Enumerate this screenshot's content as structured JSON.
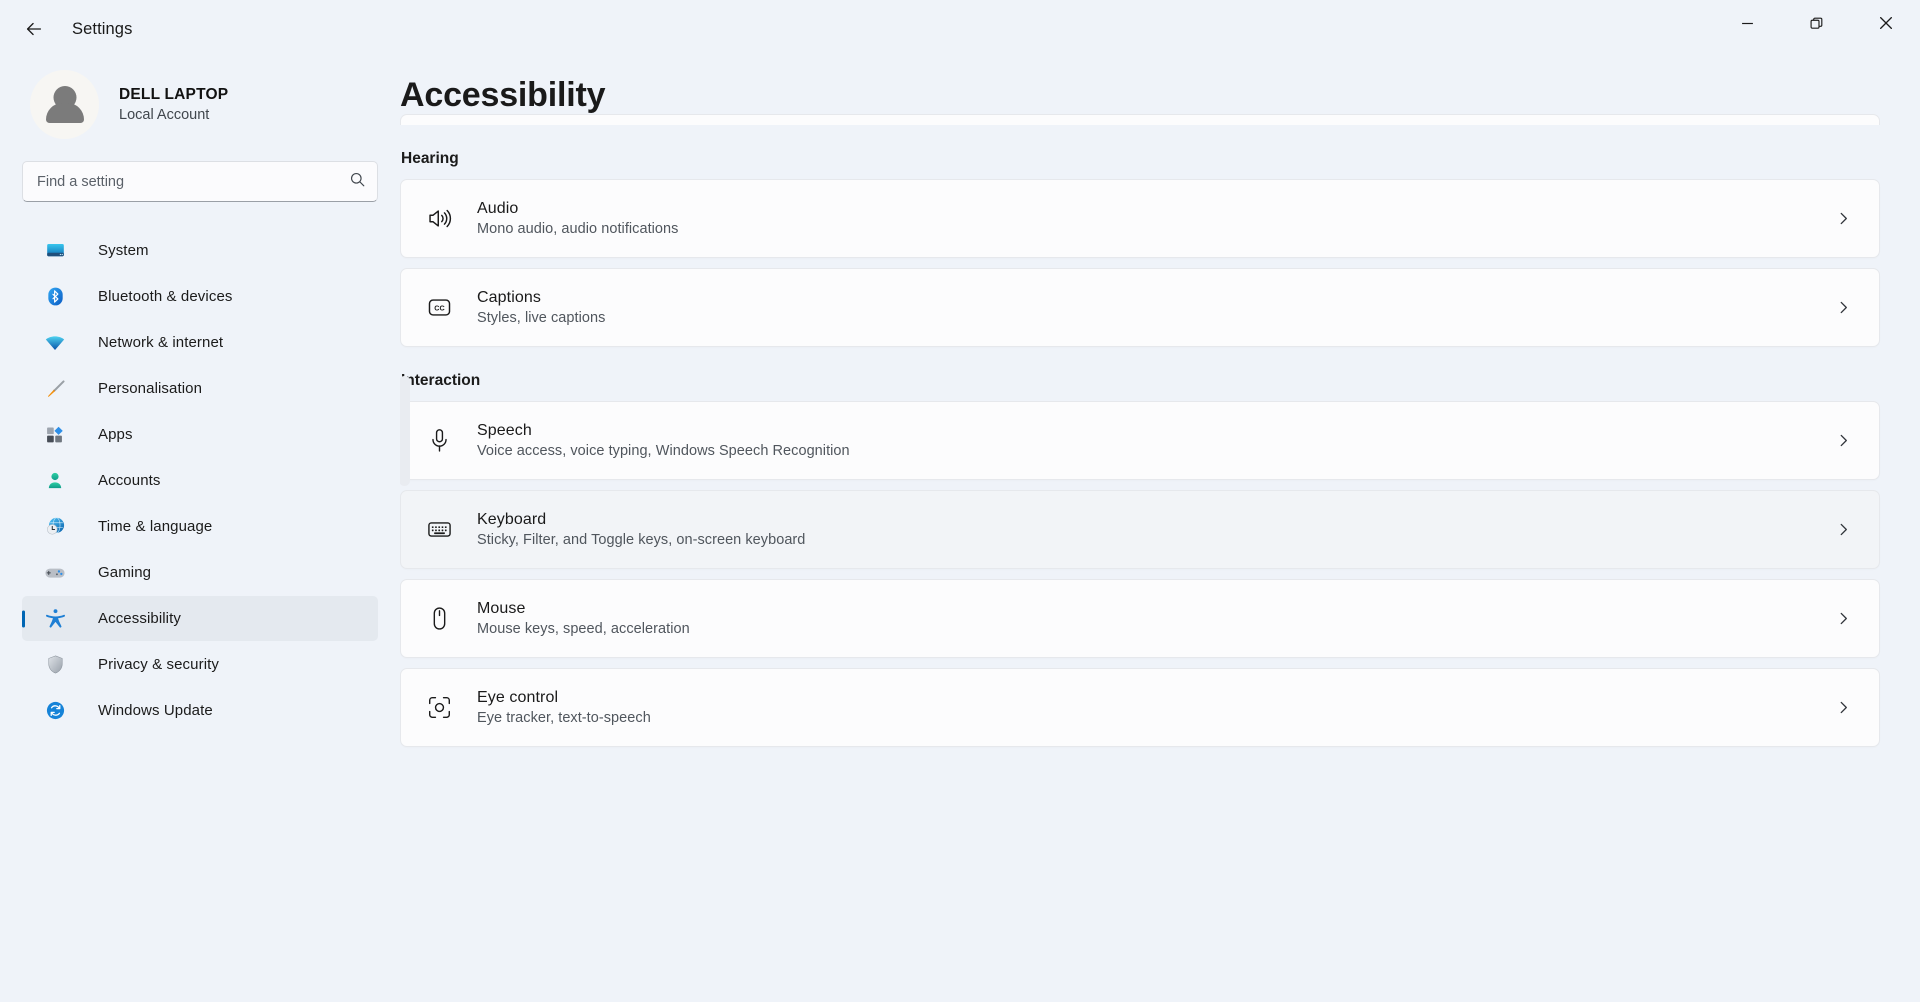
{
  "titlebar": {
    "title": "Settings",
    "back_label": "Back",
    "minimize_label": "Minimise",
    "restore_label": "Restore",
    "close_label": "Close"
  },
  "account": {
    "name": "DELL LAPTOP",
    "subtitle": "Local Account"
  },
  "search": {
    "placeholder": "Find a setting",
    "value": ""
  },
  "sidebar": {
    "items": [
      {
        "label": "System",
        "icon": "monitor-icon",
        "selected": false
      },
      {
        "label": "Bluetooth & devices",
        "icon": "bluetooth-icon",
        "selected": false
      },
      {
        "label": "Network & internet",
        "icon": "wifi-icon",
        "selected": false
      },
      {
        "label": "Personalisation",
        "icon": "paintbrush-icon",
        "selected": false
      },
      {
        "label": "Apps",
        "icon": "apps-icon",
        "selected": false
      },
      {
        "label": "Accounts",
        "icon": "person-icon",
        "selected": false
      },
      {
        "label": "Time & language",
        "icon": "clock-globe-icon",
        "selected": false
      },
      {
        "label": "Gaming",
        "icon": "gamepad-icon",
        "selected": false
      },
      {
        "label": "Accessibility",
        "icon": "accessibility-icon",
        "selected": true
      },
      {
        "label": "Privacy & security",
        "icon": "shield-icon",
        "selected": false
      },
      {
        "label": "Windows Update",
        "icon": "update-icon",
        "selected": false
      }
    ]
  },
  "main": {
    "page_title": "Accessibility",
    "sections": [
      {
        "title": "Hearing",
        "cards": [
          {
            "title": "Audio",
            "subtitle": "Mono audio, audio notifications",
            "icon": "speaker-icon",
            "hovered": false
          },
          {
            "title": "Captions",
            "subtitle": "Styles, live captions",
            "icon": "closed-caption-icon",
            "hovered": false
          }
        ]
      },
      {
        "title": "Interaction",
        "cards": [
          {
            "title": "Speech",
            "subtitle": "Voice access, voice typing, Windows Speech Recognition",
            "icon": "microphone-icon",
            "hovered": false
          },
          {
            "title": "Keyboard",
            "subtitle": "Sticky, Filter, and Toggle keys, on-screen keyboard",
            "icon": "keyboard-icon",
            "hovered": true
          },
          {
            "title": "Mouse",
            "subtitle": "Mouse keys, speed, acceleration",
            "icon": "mouse-icon",
            "hovered": false
          },
          {
            "title": "Eye control",
            "subtitle": "Eye tracker, text-to-speech",
            "icon": "eye-control-icon",
            "hovered": false
          }
        ]
      }
    ]
  },
  "colors": {
    "accent": "#0066b4",
    "page_background": "#eff3f9",
    "card_background": "#fcfcfd",
    "card_hover": "#f2f4f7",
    "selected_nav": "#e4e9ef"
  }
}
